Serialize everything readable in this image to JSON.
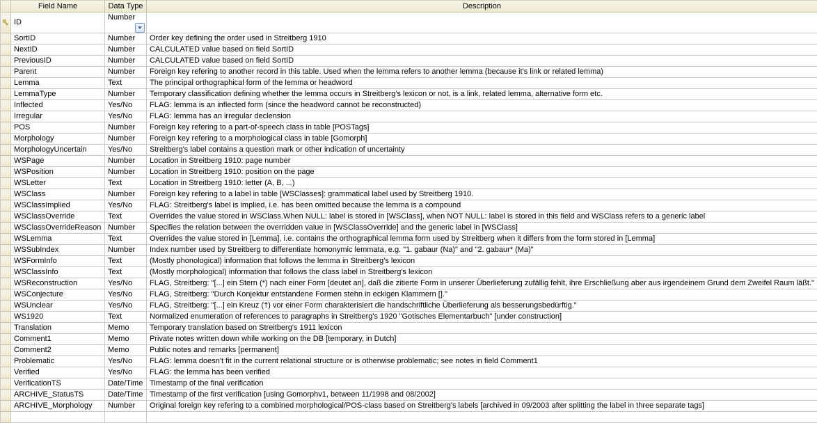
{
  "columns": {
    "selector": "",
    "field": "Field Name",
    "type": "Data Type",
    "desc": "Description"
  },
  "rows": [
    {
      "pk": true,
      "field": "ID",
      "type": "Number",
      "dropdown": true,
      "desc": ""
    },
    {
      "field": "SortID",
      "type": "Number",
      "desc": "Order key defining the order used in Streitberg 1910"
    },
    {
      "field": "NextID",
      "type": "Number",
      "desc": "CALCULATED value based on field SortID"
    },
    {
      "field": "PreviousID",
      "type": "Number",
      "desc": "CALCULATED value based on field SortID"
    },
    {
      "field": "Parent",
      "type": "Number",
      "desc": "Foreign key refering to another record in this table. Used when the lemma refers to another lemma (because it's link or related lemma)"
    },
    {
      "field": "Lemma",
      "type": "Text",
      "desc": "The principal orthographical form of the lemma or headword"
    },
    {
      "field": "LemmaType",
      "type": "Number",
      "desc": "Temporary classification defining whether the lemma occurs in Streitberg's lexicon or not, is a link, related lemma, alternative form etc."
    },
    {
      "field": "Inflected",
      "type": "Yes/No",
      "desc": "FLAG: lemma is an inflected form (since the headword cannot be reconstructed)"
    },
    {
      "field": "Irregular",
      "type": "Yes/No",
      "desc": "FLAG: lemma has an irregular declension"
    },
    {
      "field": "POS",
      "type": "Number",
      "desc": "Foreign key refering to a part-of-speech class in table [POSTags]"
    },
    {
      "field": "Morphology",
      "type": "Number",
      "desc": "Foreign key refering to a morphological class in table [Gomorph]"
    },
    {
      "field": "MorphologyUncertain",
      "type": "Yes/No",
      "desc": "Streitberg's label contains a question mark or other indication of uncertainty"
    },
    {
      "field": "WSPage",
      "type": "Number",
      "desc": "Location in Streitberg 1910: page number"
    },
    {
      "field": "WSPosition",
      "type": "Number",
      "desc": "Location in Streitberg 1910: position on the page"
    },
    {
      "field": "WSLetter",
      "type": "Text",
      "desc": "Location in Streitberg 1910: letter (A, B, ...)"
    },
    {
      "field": "WSClass",
      "type": "Number",
      "desc": "Foreign key refering to a label in table [WSClasses]: grammatical label used by Streitberg 1910."
    },
    {
      "field": "WSClassImplied",
      "type": "Yes/No",
      "desc": "FLAG: Streitberg's label is implied, i.e. has been omitted because the lemma is a compound"
    },
    {
      "field": "WSClassOverride",
      "type": "Text",
      "desc": "Overrides the value stored in WSClass.When NULL: label is stored in [WSClass], when NOT NULL: label is stored in this field and WSClass refers to a generic label"
    },
    {
      "field": "WSClassOverrideReason",
      "type": "Number",
      "desc": "Specifies the relation between the overridden value in [WSClassOverride] and the generic label in [WSClass]"
    },
    {
      "field": "WSLemma",
      "type": "Text",
      "desc": "Overrides the value stored in [Lemma], i.e. contains the orthographical lemma form used by Streitberg when it differs from the form stored in [Lemma]"
    },
    {
      "field": "WSSubIndex",
      "type": "Number",
      "desc": "Index number used by Streitberg to differentiate homonymic lemmata, e.g. \"1. gabaur (Na)\" and \"2. gabaur* (Ma)\""
    },
    {
      "field": "WSFormInfo",
      "type": "Text",
      "desc": "(Mostly phonological) information that follows the lemma in Streitberg's lexicon"
    },
    {
      "field": "WSClassInfo",
      "type": "Text",
      "desc": "(Mostly morphological) information that follows the class label in Streitberg's lexicon"
    },
    {
      "field": "WSReconstruction",
      "type": "Yes/No",
      "desc": "FLAG, Streitberg: \"[...] ein Stern (*) nach einer Form [deutet an], daß die zitierte Form in unserer Überlieferung zufällig fehlt, ihre Erschließung aber aus irgendeinem Grund dem Zweifel Raum läßt.\""
    },
    {
      "field": "WSConjecture",
      "type": "Yes/No",
      "desc": "FLAG, Streitberg: \"Durch Konjektur entstandene Formen stehn in eckigen Klammern [].\""
    },
    {
      "field": "WSUnclear",
      "type": "Yes/No",
      "desc": "FLAG, Streitberg: \"[...] ein Kreuz (†) vor einer Form charakterisiert die handschriftliche Überlieferung als besserungsbedürftig.\""
    },
    {
      "field": "WS1920",
      "type": "Text",
      "desc": "Normalized enumeration of references to paragraphs in Streitberg's 1920 \"Gotisches Elementarbuch\" [under construction]"
    },
    {
      "field": "Translation",
      "type": "Memo",
      "desc": "Temporary translation based on Streitberg's 1911 lexicon"
    },
    {
      "field": "Comment1",
      "type": "Memo",
      "desc": "Private notes written down while working on the DB [temporary, in Dutch]"
    },
    {
      "field": "Comment2",
      "type": "Memo",
      "desc": "Public notes and remarks [permanent]"
    },
    {
      "field": "Problematic",
      "type": "Yes/No",
      "desc": "FLAG: lemma doesn't fit in the current relational structure or is otherwise problematic; see notes in field Comment1"
    },
    {
      "field": "Verified",
      "type": "Yes/No",
      "desc": "FLAG: the lemma has been verified"
    },
    {
      "field": "VerificationTS",
      "type": "Date/Time",
      "desc": "Timestamp of the final verification"
    },
    {
      "field": "ARCHIVE_StatusTS",
      "type": "Date/Time",
      "desc": "Timestamp of the first verification [using Gomorphv1, between 11/1998 and 08/2002]"
    },
    {
      "field": "ARCHIVE_Morphology",
      "type": "Number",
      "desc": "Original foreign key refering to a combined morphological/POS-class based on Streitberg's labels [archived in 09/2003 after splitting the label in three separate tags]"
    }
  ]
}
